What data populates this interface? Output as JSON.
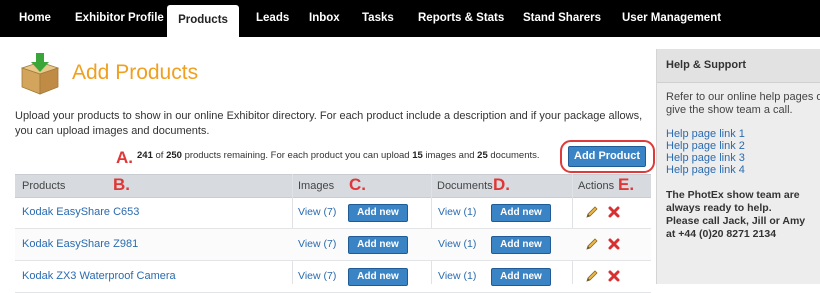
{
  "nav": {
    "items": [
      {
        "label": "Home"
      },
      {
        "label": "Exhibitor Profile"
      },
      {
        "label": "Products"
      },
      {
        "label": "Leads"
      },
      {
        "label": "Inbox"
      },
      {
        "label": "Tasks"
      },
      {
        "label": "Reports & Stats"
      },
      {
        "label": "Stand Sharers"
      },
      {
        "label": "User Management"
      }
    ],
    "active": "Products"
  },
  "page": {
    "icon": "product-box-icon",
    "title": "Add Products",
    "intro": "Upload your products to show in our online Exhibitor directory. For each product include a description and if your package allows, you can upload images and documents.",
    "remaining": {
      "used": "241",
      "of": "of",
      "total": "250",
      "mid": "products remaining. For each product you can upload",
      "images_limit": "15",
      "images_word": "images and",
      "docs_limit": "25",
      "docs_word": "documents."
    },
    "add_product_label": "Add Product"
  },
  "markers": {
    "a": "A.",
    "b": "B.",
    "c": "C.",
    "d": "D.",
    "e": "E."
  },
  "table": {
    "headers": {
      "products": "Products",
      "images": "Images",
      "documents": "Documents",
      "actions": "Actions"
    },
    "add_new_label": "Add new",
    "rows": [
      {
        "name": "Kodak EasyShare C653",
        "images": "View (7)",
        "documents": "View (1)"
      },
      {
        "name": "Kodak EasyShare Z981",
        "images": "View (7)",
        "documents": "View (1)"
      },
      {
        "name": "Kodak ZX3 Waterproof Camera",
        "images": "View (7)",
        "documents": "View (1)"
      }
    ]
  },
  "sidebar": {
    "title": "Help & Support",
    "text_line1": "Refer to our online help pages or",
    "text_line2": "give the show team a call.",
    "links": [
      "Help page link 1",
      "Help page link 2",
      "Help page link 3",
      "Help page link 4"
    ],
    "bold_lines": [
      "The PhotEx show team are",
      "always ready to help.",
      "Please call Jack, Jill or Amy",
      "at +44 (0)20 8271 2134"
    ]
  },
  "colors": {
    "accent_orange": "#f0a020",
    "button_blue": "#3a84c5",
    "marker_red": "#e03636",
    "link_blue": "#2a6bb0",
    "nav_bg": "#000000"
  }
}
